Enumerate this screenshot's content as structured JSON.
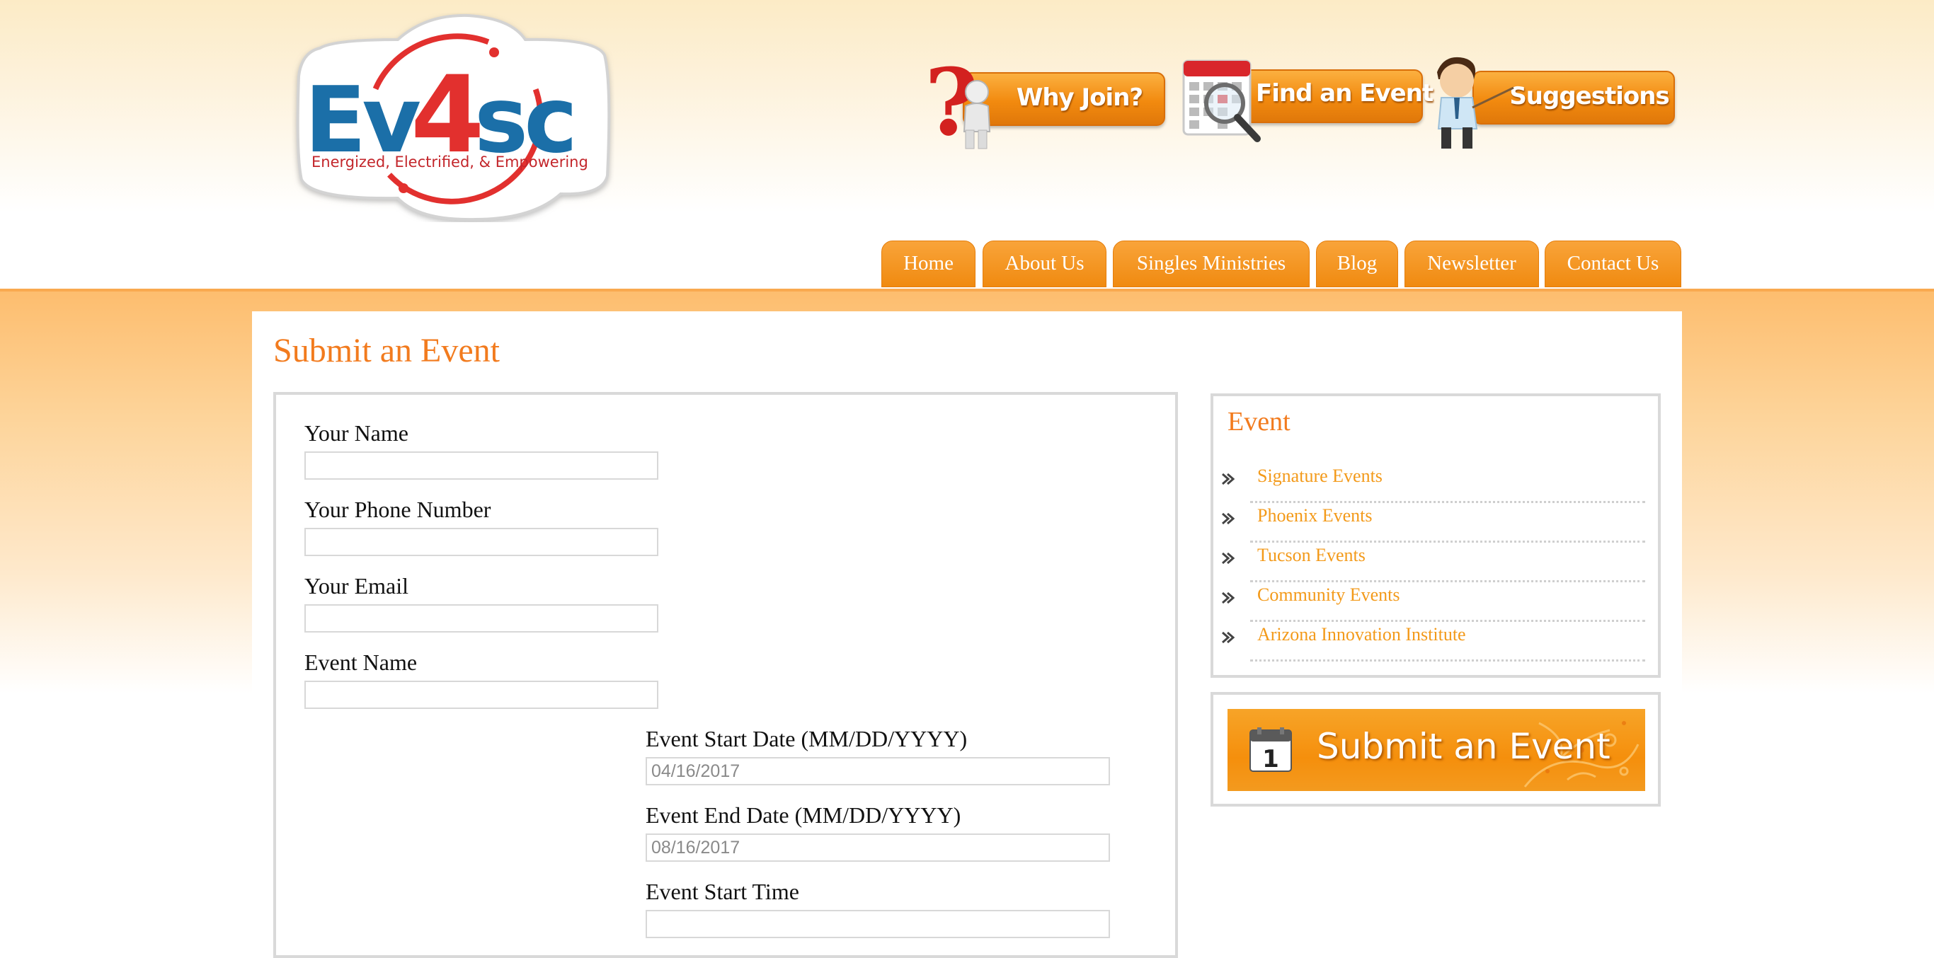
{
  "logo": {
    "text_ev": "Ev",
    "text_4": "4",
    "text_sc": "sc",
    "tagline": "Energized, Electrified, & Empowering"
  },
  "features": [
    {
      "label": "Why Join?",
      "icon": "question-mark-figure-icon"
    },
    {
      "label": "Find an Event",
      "icon": "calendar-magnifier-icon"
    },
    {
      "label": "Suggestions",
      "icon": "presenter-man-icon"
    }
  ],
  "nav": [
    "Home",
    "About Us",
    "Singles Ministries",
    "Blog",
    "Newsletter",
    "Contact Us"
  ],
  "page": {
    "title": "Submit an Event"
  },
  "form": {
    "your_name_label": "Your Name",
    "phone_label": "Your Phone Number",
    "email_label": "Your Email",
    "event_name_label": "Event Name",
    "start_date_label": "Event Start Date (MM/DD/YYYY)",
    "start_date_value": "04/16/2017",
    "end_date_label": "Event End Date (MM/DD/YYYY)",
    "end_date_value": "08/16/2017",
    "start_time_label": "Event Start Time"
  },
  "sidebar": {
    "title": "Event",
    "items": [
      "Signature Events",
      "Phoenix Events",
      "Tucson Events",
      "Community Events",
      "Arizona Innovation Institute"
    ],
    "banner_text": "Submit an Event",
    "banner_icon": "calendar-icon"
  },
  "colors": {
    "accent": "#f27b1e",
    "nav_orange": "#f08a10",
    "link": "#f39a1a",
    "logo_blue": "#1b6fa8",
    "logo_red": "#e2302e"
  }
}
